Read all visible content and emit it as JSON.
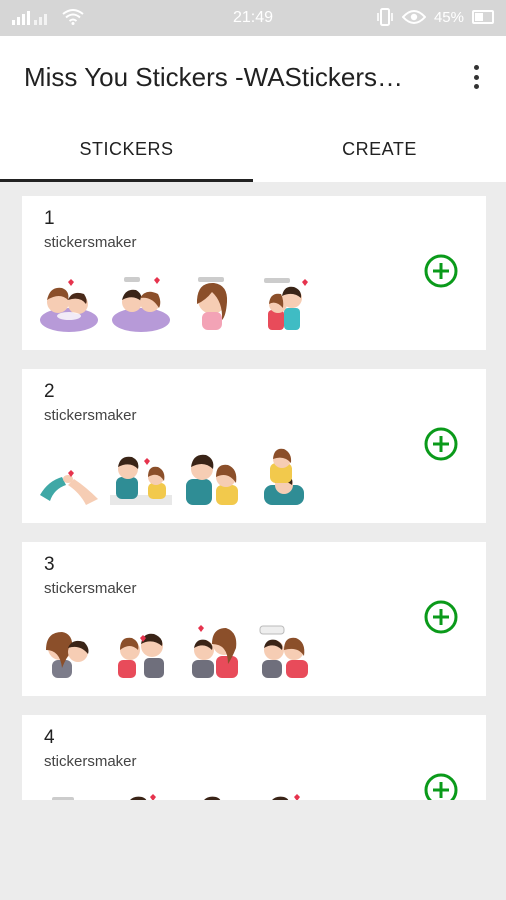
{
  "status_bar": {
    "time": "21:49",
    "battery_percent": "45%",
    "icons": [
      "signal-icon",
      "wifi-icon",
      "vibrate-icon",
      "eye-icon",
      "battery-icon"
    ]
  },
  "app_bar": {
    "title": "Miss You Stickers -WAStickers…",
    "menu_icon": "more-vert-icon"
  },
  "tabs": [
    {
      "label": "STICKERS",
      "active": true
    },
    {
      "label": "CREATE",
      "active": false
    }
  ],
  "packs": [
    {
      "number": "1",
      "author": "stickersmaker"
    },
    {
      "number": "2",
      "author": "stickersmaker"
    },
    {
      "number": "3",
      "author": "stickersmaker"
    },
    {
      "number": "4",
      "author": "stickersmaker"
    }
  ],
  "colors": {
    "accent_green": "#0a9a1a",
    "tab_indicator": "#222222",
    "background": "#ececec",
    "status_bar": "#d6d6d6"
  }
}
